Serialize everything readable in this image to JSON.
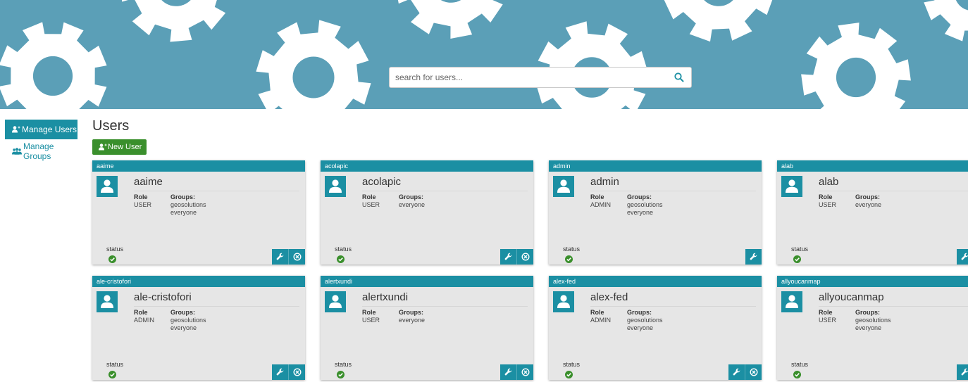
{
  "header": {
    "search_placeholder": "search for users...",
    "search_icon": "search-icon",
    "banner_colors": {
      "background": "#5b9fb7",
      "gear": "#ffffff"
    }
  },
  "sidebar": {
    "items": [
      {
        "label": "Manage Users",
        "icon": "user-add-icon",
        "active": true
      },
      {
        "label": "Manage Groups",
        "icon": "group-icon",
        "active": false
      }
    ]
  },
  "main": {
    "title": "Users",
    "new_user_label": "New User"
  },
  "users": [
    {
      "header": "aaime",
      "name": "aaime",
      "role_label": "Role",
      "role": "USER",
      "groups_label": "Groups:",
      "groups": [
        "geosolutions",
        "everyone"
      ],
      "status_label": "status",
      "status": "active",
      "can_delete": true
    },
    {
      "header": "acolapic",
      "name": "acolapic",
      "role_label": "Role",
      "role": "USER",
      "groups_label": "Groups:",
      "groups": [
        "everyone"
      ],
      "status_label": "status",
      "status": "active",
      "can_delete": true
    },
    {
      "header": "admin",
      "name": "admin",
      "role_label": "Role",
      "role": "ADMIN",
      "groups_label": "Groups:",
      "groups": [
        "geosolutions",
        "everyone"
      ],
      "status_label": "status",
      "status": "active",
      "can_delete": false
    },
    {
      "header": "alab",
      "name": "alab",
      "role_label": "Role",
      "role": "USER",
      "groups_label": "Groups:",
      "groups": [
        "everyone"
      ],
      "status_label": "status",
      "status": "active",
      "can_delete": true
    },
    {
      "header": "ale-cristofori",
      "name": "ale-cristofori",
      "role_label": "Role",
      "role": "ADMIN",
      "groups_label": "Groups:",
      "groups": [
        "geosolutions",
        "everyone"
      ],
      "status_label": "status",
      "status": "active",
      "can_delete": true
    },
    {
      "header": "alertxundi",
      "name": "alertxundi",
      "role_label": "Role",
      "role": "USER",
      "groups_label": "Groups:",
      "groups": [
        "everyone"
      ],
      "status_label": "status",
      "status": "active",
      "can_delete": true
    },
    {
      "header": "alex-fed",
      "name": "alex-fed",
      "role_label": "Role",
      "role": "ADMIN",
      "groups_label": "Groups:",
      "groups": [
        "geosolutions",
        "everyone"
      ],
      "status_label": "status",
      "status": "active",
      "can_delete": true
    },
    {
      "header": "allyoucanmap",
      "name": "allyoucanmap",
      "role_label": "Role",
      "role": "USER",
      "groups_label": "Groups:",
      "groups": [
        "geosolutions",
        "everyone"
      ],
      "status_label": "status",
      "status": "active",
      "can_delete": true
    }
  ],
  "colors": {
    "accent": "#1b8fa3",
    "new_user": "#3a8f2c",
    "status_ok": "#3a8f2c",
    "card_bg": "#e6e6e6"
  }
}
